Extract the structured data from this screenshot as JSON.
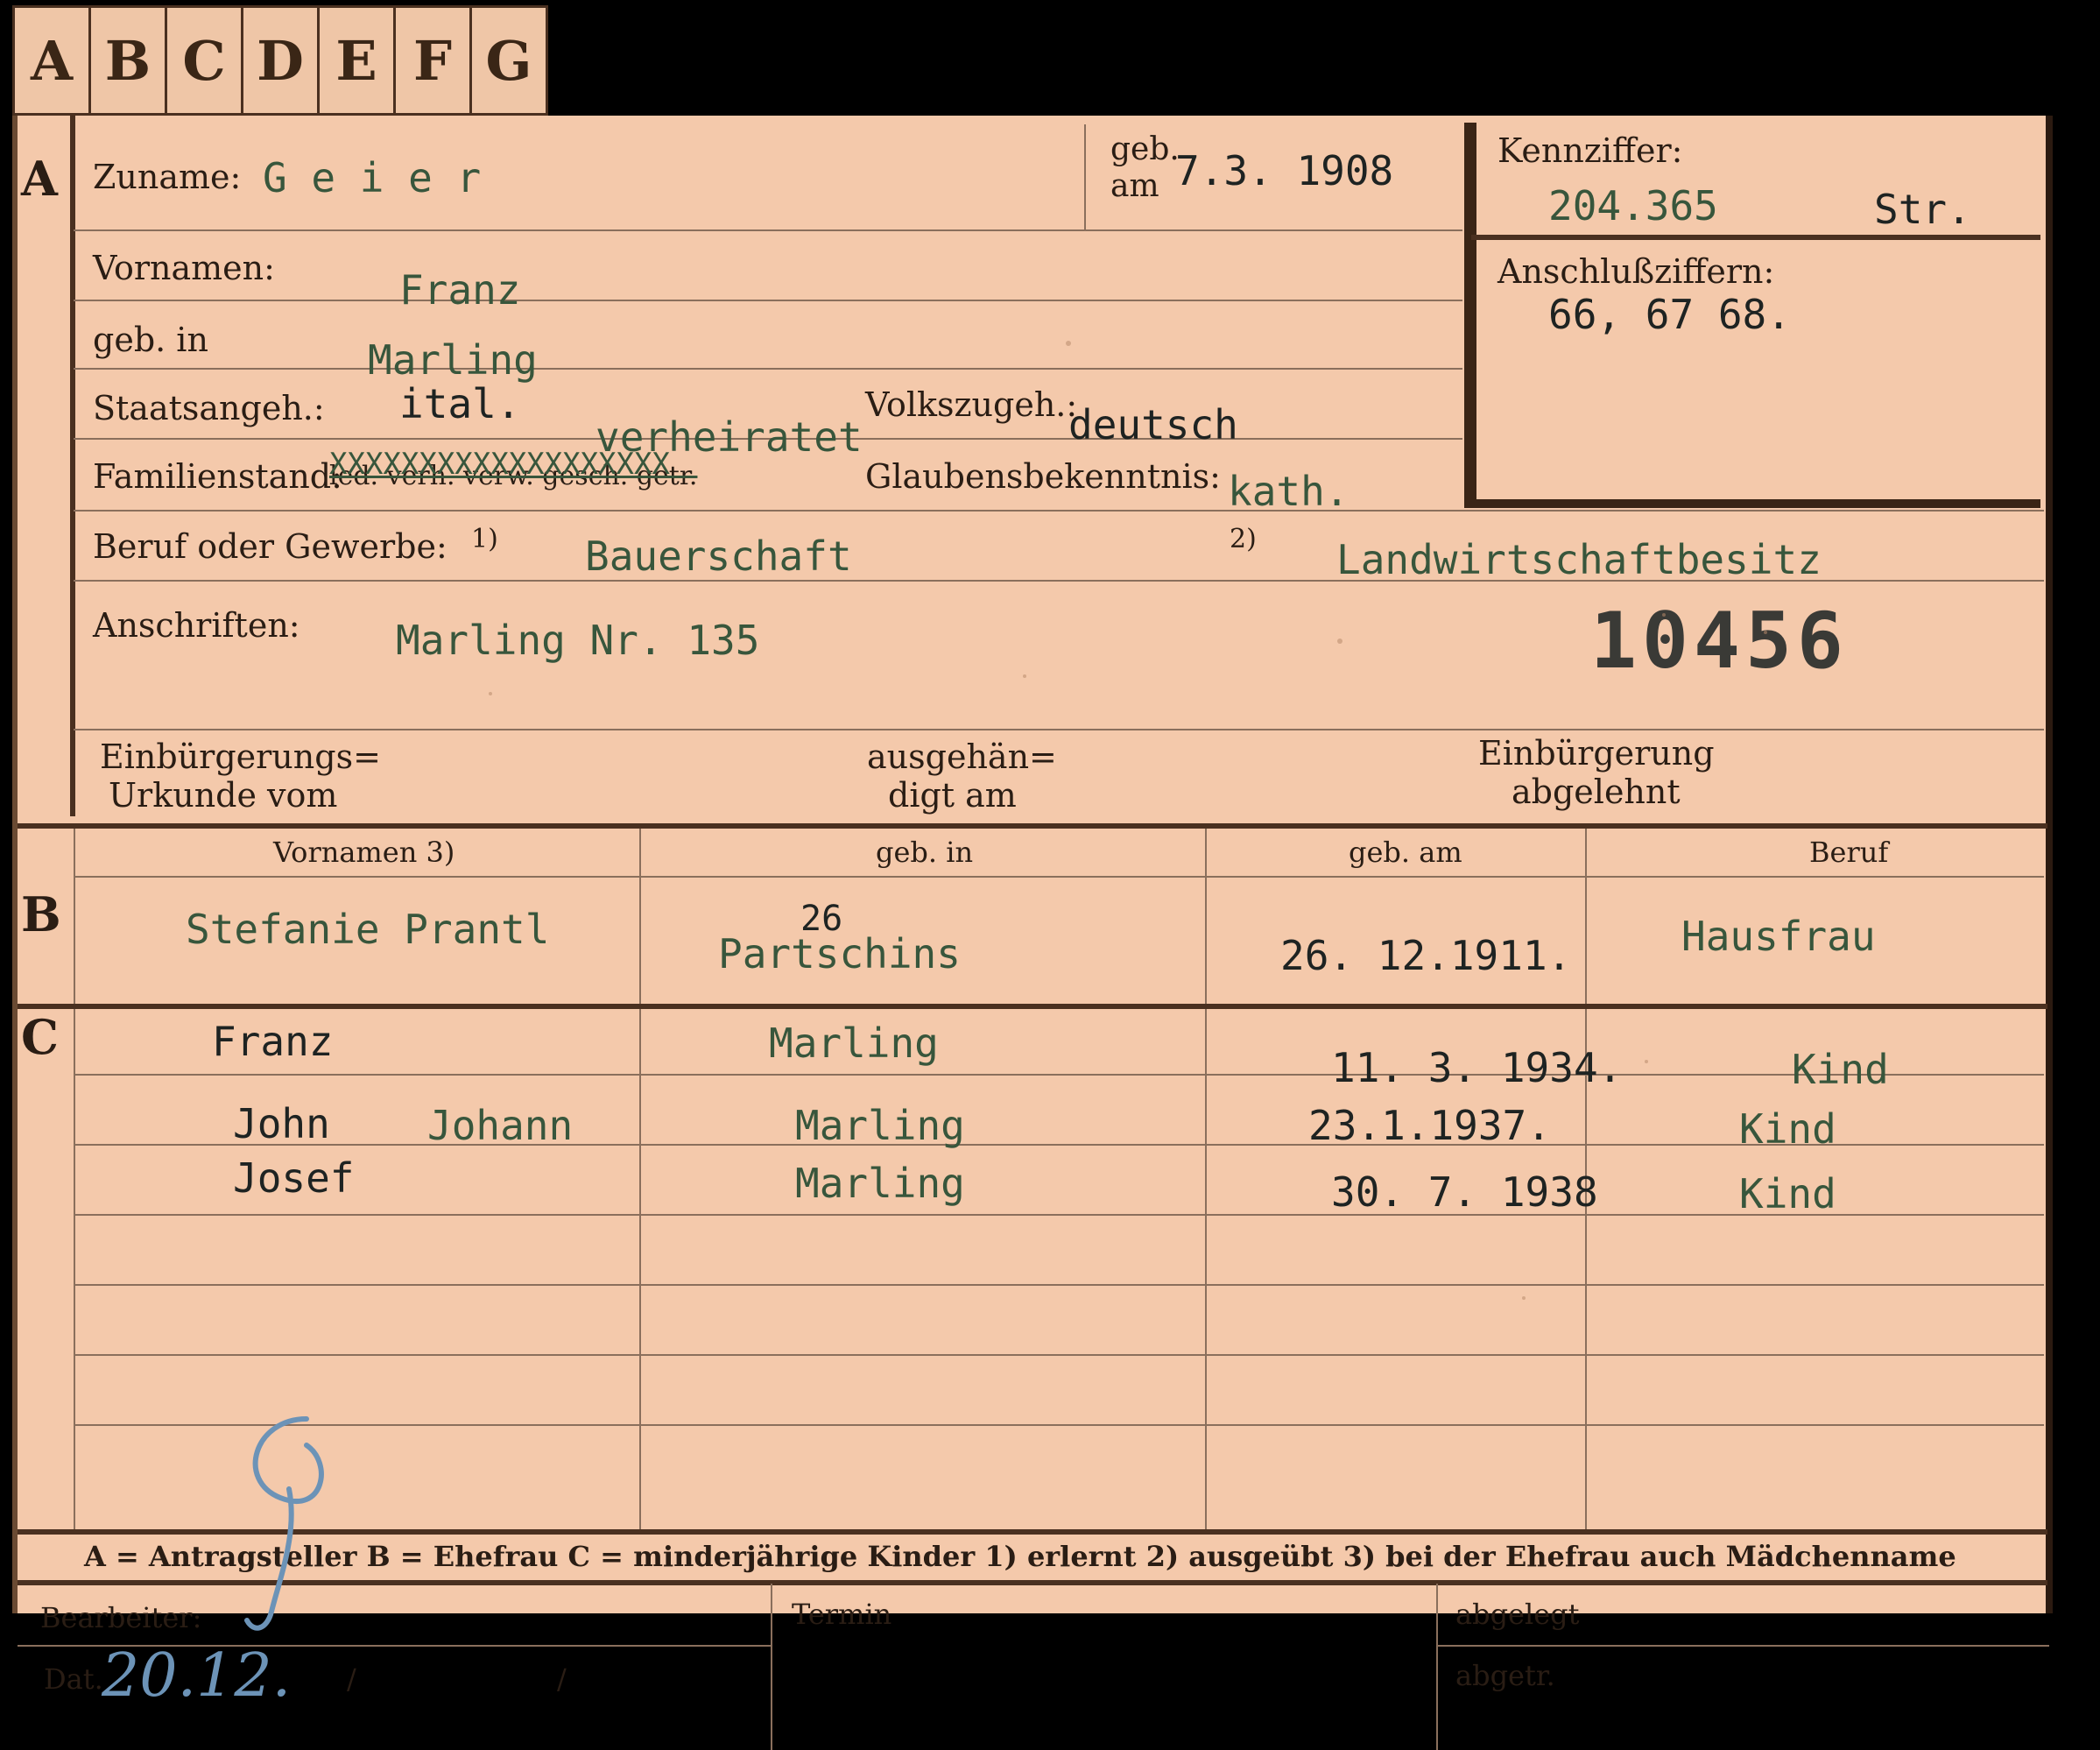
{
  "tabs": [
    "A",
    "B",
    "C",
    "D",
    "E",
    "F",
    "G"
  ],
  "sections": {
    "a": "A",
    "b": "B",
    "c": "C"
  },
  "section_a": {
    "surname_label": "Zuname:",
    "surname_value": "G e i e r",
    "born_on_label_1": "geb.",
    "born_on_label_2": "am",
    "born_on_value": "7.3. 1908",
    "kennziffer_label": "Kennziffer:",
    "kennziffer_value": "204.365",
    "kennziffer_suffix": "Str.",
    "anschluss_label": "Anschlußziffern:",
    "anschluss_value": "66, 67 68.",
    "first_names_label": "Vornamen:",
    "first_names_value": "Franz",
    "birthplace_label": "geb. in",
    "birthplace_value": "Marling",
    "citizenship_label": "Staatsangeh.:",
    "citizenship_value": "ital.",
    "marital_typed": "verheiratet",
    "ethnicity_label": "Volkszugeh.:",
    "ethnicity_value": "deutsch",
    "marital_label": "Familienstand:",
    "marital_printed": "led. verh. verw. gesch. getr.",
    "marital_strike": "XXXXXXXXXXXXXXXXXXX",
    "religion_label": "Glaubensbekenntnis:",
    "religion_value": "kath.",
    "occupation_label": "Beruf oder Gewerbe:",
    "occupation_mark1": "1)",
    "occupation_value1": "Bauerschaft",
    "occupation_mark2": "2)",
    "occupation_value2": "Landwirtschaftbesitz",
    "address_label": "Anschriften:",
    "address_value": "Marling Nr. 135",
    "stamp_number": "10456",
    "naturalization_label_1": "Einbürgerungs=",
    "naturalization_label_2": "Urkunde vom",
    "handed_label_1": "ausgehän=",
    "handed_label_2": "digt am",
    "rejected_label_1": "Einbürgerung",
    "rejected_label_2": "abgelehnt"
  },
  "section_b": {
    "headers": [
      "Vornamen 3)",
      "geb. in",
      "geb. am",
      "Beruf"
    ],
    "spouse": {
      "first_names": "Stefanie Prantl",
      "place_correction": "26",
      "place": "Partschins",
      "date": "26. 12.1911.",
      "occupation": "Hausfrau"
    }
  },
  "section_c": {
    "children": [
      {
        "name": "Franz",
        "place": "Marling",
        "date": "11. 3. 1934.",
        "occupation": "Kind"
      },
      {
        "name": "John",
        "name_extra": "Johann",
        "place": "Marling",
        "date": "23.1.1937.",
        "occupation": "Kind"
      },
      {
        "name": "Josef",
        "place": "Marling",
        "date": "30. 7. 1938",
        "occupation": "Kind"
      }
    ]
  },
  "footer": {
    "legend": "A = Antragsteller   B = Ehefrau   C = minderjährige Kinder   1) erlernt   2) ausgeübt   3) bei der Ehefrau auch Mädchenname",
    "clerk_label": "Bearbeiter:",
    "date_label": "Dat.",
    "date_handwritten": "20.12.",
    "slash1": "/",
    "slash2": "/",
    "termin_label": "Termin",
    "filed_label": "abgelegt",
    "removed_label": "abgetr."
  },
  "colors": {
    "card": "#f4c9ab",
    "typed_ink": "#38563c",
    "pencil": "#6c93b7",
    "rule": "#4a3020"
  }
}
